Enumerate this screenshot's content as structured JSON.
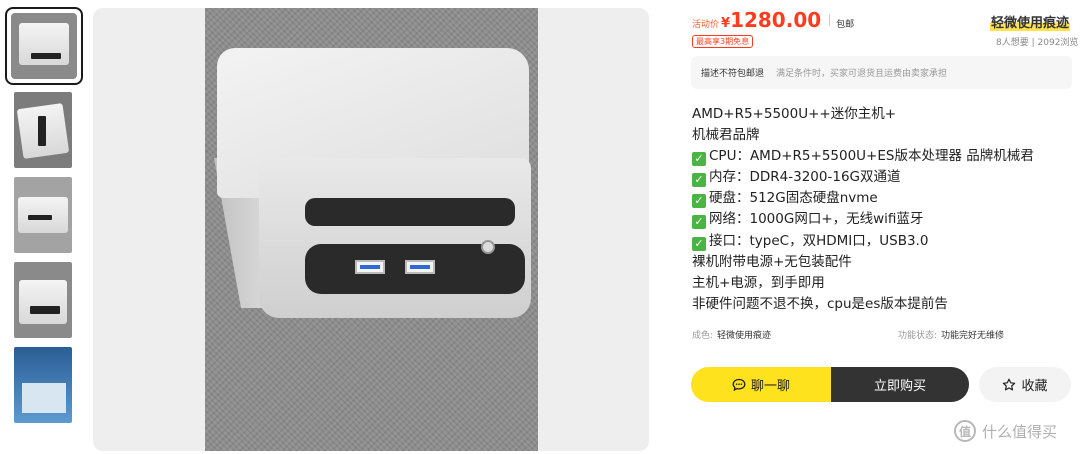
{
  "price": {
    "label": "活动价",
    "currency": "¥",
    "value": "1280.00",
    "shipping": "包邮"
  },
  "condition_badge": "轻微使用痕迹",
  "installment": "最高享3期免息",
  "stats": {
    "wants": "8人想要",
    "divider": "|",
    "views": "2092浏览"
  },
  "notice": {
    "title": "描述不符包邮退",
    "text": "满足条件时，买家可退货且运费由卖家承担"
  },
  "description": [
    {
      "check": false,
      "text": "AMD+R5+5500U++迷你主机+"
    },
    {
      "check": false,
      "text": "机械君品牌"
    },
    {
      "check": true,
      "text": "CPU：AMD+R5+5500U+ES版本处理器 品牌机械君"
    },
    {
      "check": true,
      "text": "内存：DDR4-3200-16G双通道"
    },
    {
      "check": true,
      "text": "硬盘：512G固态硬盘nvme"
    },
    {
      "check": true,
      "text": "网络：1000G网口+，无线wifi蓝牙"
    },
    {
      "check": true,
      "text": "接口：typeC，双HDMI口，USB3.0"
    },
    {
      "check": false,
      "text": "裸机附带电源+无包装配件"
    },
    {
      "check": false,
      "text": "主机+电源，到手即用"
    },
    {
      "check": false,
      "text": "非硬件问题不退不换，cpu是es版本提前告"
    }
  ],
  "attributes": [
    {
      "key": "成色:",
      "value": "轻微使用痕迹"
    },
    {
      "key": "功能状态:",
      "value": "功能完好无维修"
    }
  ],
  "buttons": {
    "chat": "聊一聊",
    "buy": "立即购买",
    "favorite": "收藏"
  },
  "watermark": {
    "icon_char": "值",
    "text": "什么值得买"
  },
  "colors": {
    "accent_yellow": "#ffe21e",
    "price_red": "#ff3c1e",
    "buy_dark": "#333333"
  },
  "icons": [
    "chat-icon",
    "star-icon",
    "check-icon"
  ]
}
